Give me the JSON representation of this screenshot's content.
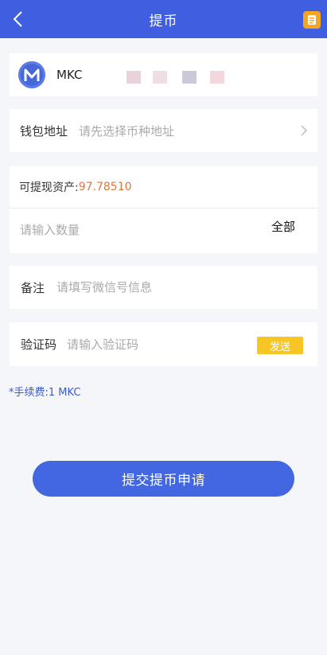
{
  "header": {
    "title": "提币",
    "back_icon": "chevron-left-icon",
    "record_icon": "record-icon"
  },
  "coin": {
    "name": "MKC",
    "logo_letter": "M",
    "logo_color": "#4667d8"
  },
  "address": {
    "label": "钱包地址",
    "placeholder": "请先选择币种地址"
  },
  "asset": {
    "label": "可提现资产:",
    "value": "97.78510"
  },
  "amount": {
    "placeholder": "请输入数量",
    "all_label": "全部"
  },
  "memo": {
    "label": "备注",
    "placeholder": "请填写微信号信息"
  },
  "verify": {
    "label": "验证码",
    "placeholder": "请输入验证码",
    "send_label": "发送"
  },
  "fee_text": "*手续费:1 MKC",
  "submit_label": "提交提币申请",
  "colors": {
    "primary": "#3f5fe0",
    "accent_orange": "#e0763a",
    "send_yellow": "#f7c624",
    "background": "#f4f6fa"
  }
}
